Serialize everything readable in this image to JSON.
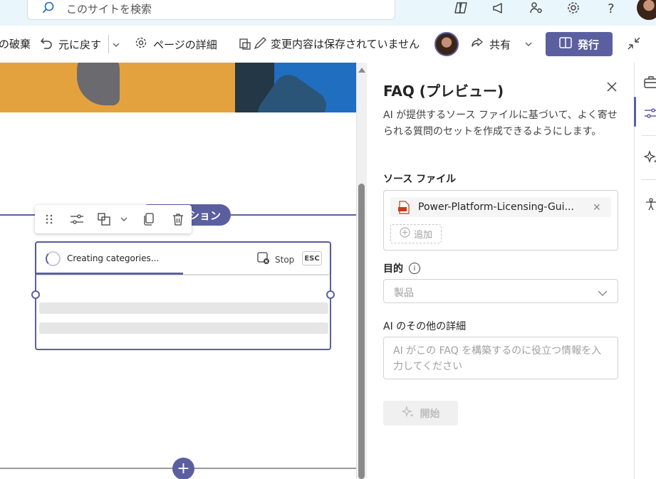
{
  "topbar": {
    "search_placeholder": "このサイトを検索",
    "icons": [
      "copilot-icon",
      "megaphone-icon",
      "people-settings-icon",
      "gear-icon",
      "help-icon"
    ]
  },
  "commandbar": {
    "discard_label": "の破棄",
    "undo_label": "元に戻す",
    "page_details_label": "ページの詳細",
    "unsaved_status": "変更内容は保存されていません",
    "share_label": "共有",
    "publish_label": "発行"
  },
  "canvas": {
    "section_label": "ション",
    "status_text": "Creating categories...",
    "stop_label": "Stop",
    "esc_label": "ESC",
    "progress": 0.5
  },
  "panel": {
    "title": "FAQ (プレビュー)",
    "description": "AI が提供するソース ファイルに基づいて、よく寄せられる質問のセットを作成できるようにします。",
    "source_label": "ソース ファイル",
    "file_name": "Power-Platform-Licensing-Gui...",
    "add_label": "追加",
    "purpose_label": "目的",
    "purpose_value": "製品",
    "details_label": "AI のその他の詳細",
    "details_placeholder": "AI がこの FAQ を構築するのに役立つ情報を入力してください",
    "start_label": "開始"
  },
  "colors": {
    "accent": "#5b5fa0",
    "topbar_bg": "#e9f6fb"
  }
}
